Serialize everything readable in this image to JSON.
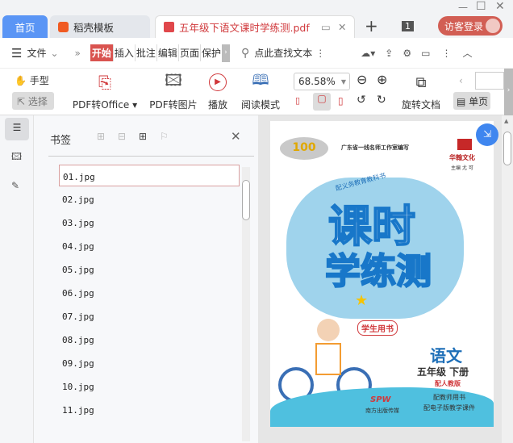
{
  "tabs": [
    {
      "label": "首页"
    },
    {
      "label": "稻壳模板"
    },
    {
      "label": "五年级下语文课时学练测.pdf"
    }
  ],
  "tab_count": "1",
  "login_label": "访客登录",
  "menu": {
    "file": "文件",
    "ribbon_tabs": [
      "开始",
      "插入",
      "批注",
      "编辑",
      "页面",
      "保护"
    ],
    "search": "点此查找文本"
  },
  "toolbar": {
    "hand": "手型",
    "select": "选择",
    "pdf_office": "PDF转Office",
    "pdf_image": "PDF转图片",
    "play": "播放",
    "read_mode": "阅读模式",
    "zoom": "68.58%",
    "rotate": "旋转文档",
    "single_page": "单页"
  },
  "bookmarks": {
    "title": "书签",
    "items": [
      "01.jpg",
      "02.jpg",
      "03.jpg",
      "04.jpg",
      "05.jpg",
      "06.jpg",
      "07.jpg",
      "08.jpg",
      "09.jpg",
      "10.jpg",
      "11.jpg"
    ]
  },
  "cover": {
    "editor": "广东省一线名师工作室编写",
    "brand": "华翰文化",
    "chief": "主编 尤 可",
    "series": "配义务教育教科书",
    "title1": "课时",
    "title2": "学练测",
    "student": "学生用书",
    "subject": "语文",
    "grade": "五年级 下册",
    "edition": "配人教版",
    "extra1": "配教师用书",
    "extra2": "配电子版教学课件",
    "publisher": "南方出版传媒",
    "logo": "SPW"
  },
  "colors": {
    "accent": "#d9534f",
    "tab_active": "#4e8ef7"
  }
}
